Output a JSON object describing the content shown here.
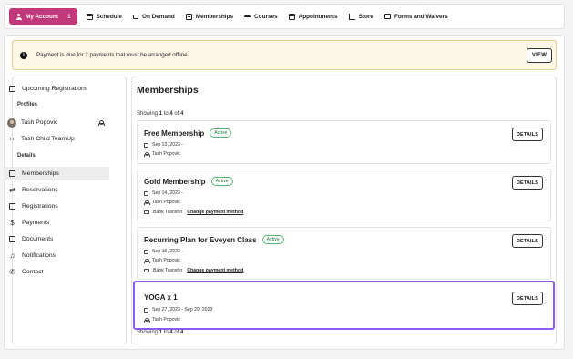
{
  "nav": {
    "items": [
      {
        "label": "My Account",
        "count": "1",
        "icon": "user-icon"
      },
      {
        "label": "Schedule",
        "icon": "calendar-icon"
      },
      {
        "label": "On Demand",
        "icon": "video-icon"
      },
      {
        "label": "Memberships",
        "icon": "card-icon"
      },
      {
        "label": "Courses",
        "icon": "graduation-cap-icon"
      },
      {
        "label": "Appointments",
        "icon": "calendar-icon"
      },
      {
        "label": "Store",
        "icon": "cart-icon"
      },
      {
        "label": "Forms and Waivers",
        "icon": "folder-icon"
      }
    ],
    "active_color": "#c1397a"
  },
  "alert": {
    "message": "Payment is due for 2 payments that must be arranged offline.",
    "button": "VIEW"
  },
  "sidebar": {
    "upcoming": "Upcoming Registrations",
    "profiles_heading": "Profiles",
    "profiles": [
      {
        "name": "Tash Popovic"
      },
      {
        "name": "Tash Child TeamUp",
        "initials": "TT"
      }
    ],
    "details_heading": "Details",
    "details": [
      "Memberships",
      "Reservations",
      "Registrations",
      "Payments",
      "Documents",
      "Notifications",
      "Contact"
    ]
  },
  "main": {
    "title": "Memberships",
    "showing": {
      "prefix": "Showing",
      "from": "1",
      "to_word": "to",
      "to": "4",
      "of_word": "of",
      "total": "4"
    },
    "cards": [
      {
        "title": "Free Membership",
        "status": "Active",
        "dates": "Sep 13, 2023 -",
        "person": "Tash Popovic",
        "button": "DETAILS"
      },
      {
        "title": "Gold Membership",
        "status": "Active",
        "dates": "Sep 14, 2023 -",
        "person": "Tash Popovic",
        "payment": "Bank Transfer",
        "payment_link": "Change payment method",
        "button": "DETAILS"
      },
      {
        "title": "Recurring Plan for Eveyen Class",
        "status": "Active",
        "dates": "Sep 15, 2023 -",
        "person": "Tash Popovic",
        "payment": "Bank Transfer",
        "payment_link": "Change payment method",
        "button": "DETAILS"
      },
      {
        "title": "YOGA x 1",
        "dates": "Sep 27, 2023 - Sep 29, 2023",
        "person": "Tash Popovic",
        "button": "DETAILS"
      }
    ],
    "selected_border_color": "#8b5cf6",
    "badge_color": "#1e7a35"
  }
}
